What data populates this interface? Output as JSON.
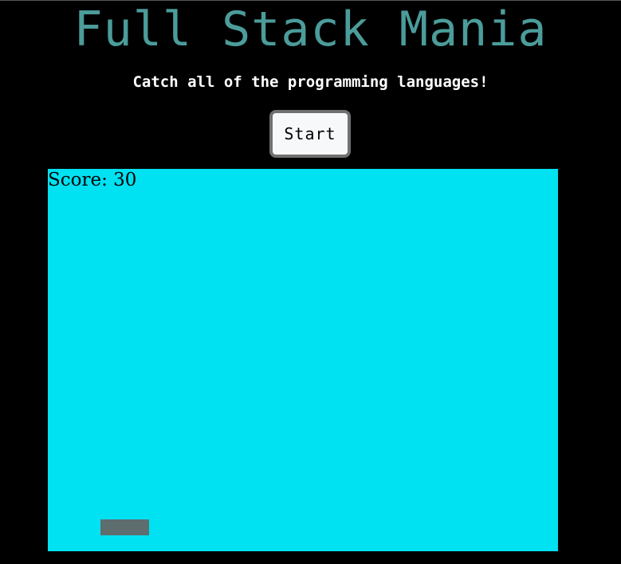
{
  "header": {
    "title": "Full Stack Mania",
    "subtitle": "Catch all of the programming languages!"
  },
  "controls": {
    "start_label": "Start"
  },
  "game": {
    "score_label": "Score: ",
    "score_value": "30"
  },
  "colors": {
    "background": "#000000",
    "title": "#4b9c9a",
    "game_area": "#00e1f2",
    "paddle": "#5e6d6e"
  }
}
